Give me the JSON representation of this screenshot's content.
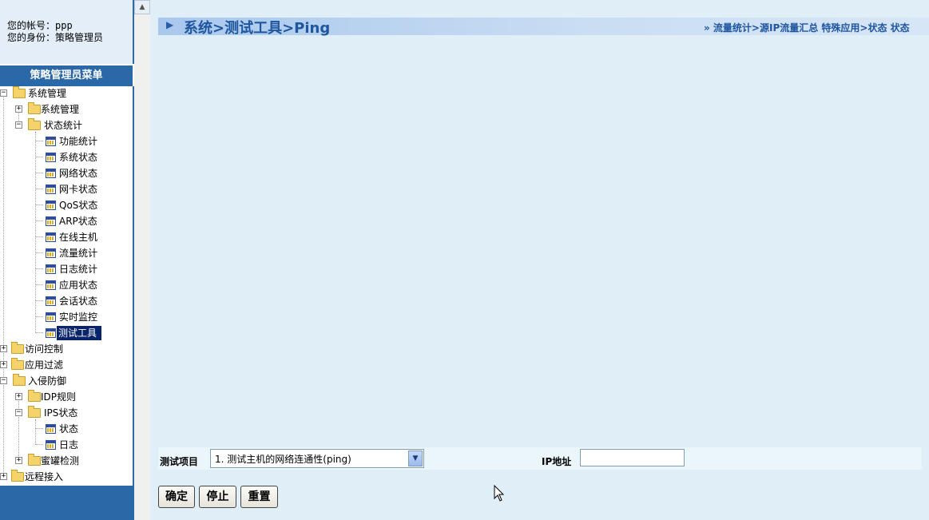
{
  "account": {
    "username_line": "您的帐号：ppp",
    "role_line": "您的身份：策略管理员"
  },
  "menu": {
    "header": "策略管理员菜单",
    "items": [
      {
        "label": "系统管理"
      },
      {
        "label": "系统管理"
      },
      {
        "label": "状态统计"
      },
      {
        "label": "功能统计"
      },
      {
        "label": "系统状态"
      },
      {
        "label": "网络状态"
      },
      {
        "label": "网卡状态"
      },
      {
        "label": "QoS状态"
      },
      {
        "label": "ARP状态"
      },
      {
        "label": "在线主机"
      },
      {
        "label": "流量统计"
      },
      {
        "label": "日志统计"
      },
      {
        "label": "应用状态"
      },
      {
        "label": "会话状态"
      },
      {
        "label": "实时监控"
      },
      {
        "label": "测试工具"
      },
      {
        "label": "访问控制"
      },
      {
        "label": "应用过滤"
      },
      {
        "label": "入侵防御"
      },
      {
        "label": "IDP规则"
      },
      {
        "label": "IPS状态"
      },
      {
        "label": "状态"
      },
      {
        "label": "日志"
      },
      {
        "label": "蜜罐检测"
      },
      {
        "label": "远程接入"
      }
    ]
  },
  "page": {
    "title": "系统>测试工具>Ping",
    "breadcrumbs": "»  流量统计>源IP流量汇总  特殊应用>状态  状态"
  },
  "form": {
    "item_label": "测试项目",
    "item_selected": "1. 测试主机的网络连通性(ping)",
    "ip_label": "IP地址",
    "ip_value": ""
  },
  "buttons": {
    "confirm": "确定",
    "stop": "停止",
    "reset": "重置"
  },
  "colors": {
    "menu_blue": "#2b68a8",
    "title_text": "#1f56a0",
    "selected_bg": "#0a246a"
  }
}
